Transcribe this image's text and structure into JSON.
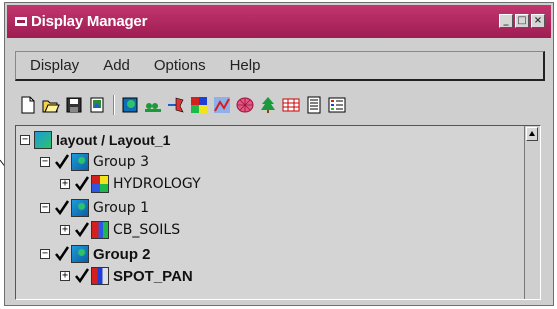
{
  "window": {
    "title": "Display Manager"
  },
  "menubar": {
    "items": [
      "Display",
      "Add",
      "Options",
      "Help"
    ]
  },
  "toolbar": {
    "icons": [
      "new-icon",
      "open-icon",
      "save-icon",
      "print-icon",
      "add-image-icon",
      "add-layer-icon",
      "add-vector-icon",
      "add-raster-icon",
      "add-chart-icon",
      "add-grid-icon",
      "add-tree-icon",
      "add-table-icon",
      "list-icon",
      "legend-icon"
    ]
  },
  "tree": {
    "root": {
      "label": "layout / Layout_1",
      "expanded": true
    },
    "groups": [
      {
        "label": "Group 3",
        "bold": false,
        "layer": {
          "label": "HYDROLOGY",
          "bold": false
        }
      },
      {
        "label": "Group 1",
        "bold": false,
        "layer": {
          "label": "CB_SOILS",
          "bold": false
        }
      },
      {
        "label": "Group 2",
        "bold": true,
        "layer": {
          "label": "SPOT_PAN",
          "bold": true
        }
      }
    ]
  },
  "colors": {
    "titlebar": "#b02a62",
    "window_bg": "#cfcfcf",
    "tree_bg": "#d4d4d4"
  }
}
